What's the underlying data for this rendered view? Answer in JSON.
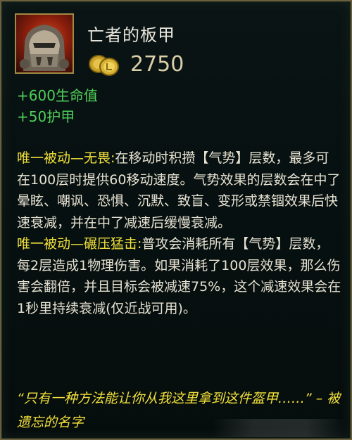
{
  "item": {
    "name": "亡者的板甲",
    "price": "2750",
    "icon": "dead-mans-plate-helmet-icon"
  },
  "stats": [
    "+600生命值",
    "+50护甲"
  ],
  "passives": [
    {
      "label": "唯一被动—无畏:",
      "text": "在移动时积攒【气势】层数，最多可在100层时提供60移动速度。气势效果的层数会在中了晕眩、嘲讽、恐惧、沉默、致盲、变形或禁锢效果后快速衰减，并在中了减速后缓慢衰减。"
    },
    {
      "label": "唯一被动—碾压猛击:",
      "text": "普攻会消耗所有【气势】层数，每2层造成1物理伤害。如果消耗了100层效果，那么伤害会翻倍，并且目标会被减速75%，这个减速效果会在1秒里持续衰减(仅近战可用)。"
    }
  ],
  "flavor": "“只有一种方法能让你从我这里拿到这件盔甲……” – 被遗忘的名字",
  "colors": {
    "stat_green": "#4fd05a",
    "unique_yellow": "#f2e13a",
    "border_gold": "#6b5f3c"
  }
}
